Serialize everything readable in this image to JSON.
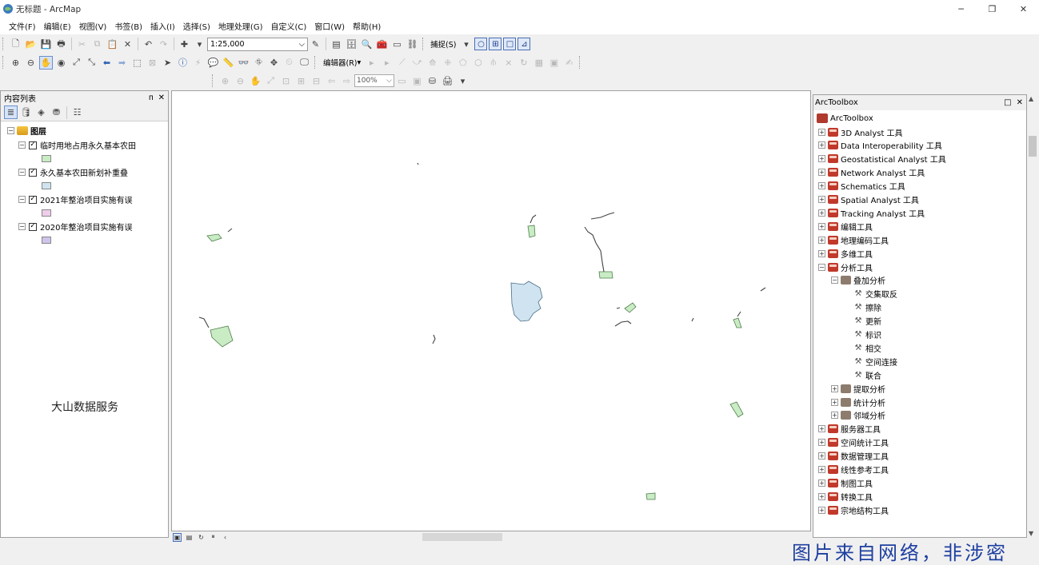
{
  "window": {
    "title": "无标题 - ArcMap",
    "minimize": "─",
    "maximize": "❐",
    "close": "✕"
  },
  "menu": [
    "文件(F)",
    "编辑(E)",
    "视图(V)",
    "书签(B)",
    "插入(I)",
    "选择(S)",
    "地理处理(G)",
    "自定义(C)",
    "窗口(W)",
    "帮助(H)"
  ],
  "toolbar": {
    "scale": "1:25,000",
    "snapping_label": "捕捉(S)",
    "editor_label": "编辑器(R)",
    "layout_zoom": "100%"
  },
  "toc": {
    "title": "内容列表",
    "pin": "ᴨ",
    "close": "✕",
    "root_label": "图层",
    "layers": [
      {
        "name": "临时用地占用永久基本农田",
        "checked": "✓",
        "color": "#c9ecc4"
      },
      {
        "name": "永久基本农田新划补重叠",
        "checked": "✓",
        "color": "#cfe4f0"
      },
      {
        "name": "2021年整治项目实施有误",
        "checked": "✓",
        "color": "#efcdeb"
      },
      {
        "name": "2020年整治项目实施有误",
        "checked": "✓",
        "color": "#cfc4ea"
      }
    ],
    "overlay_text": "大山数据服务"
  },
  "toolbox": {
    "title": "ArcToolbox",
    "restore": "□",
    "close": "✕",
    "root": "ArcToolbox",
    "items": [
      {
        "label": "3D Analyst 工具",
        "level": 0,
        "kind": "box",
        "exp": "+"
      },
      {
        "label": "Data Interoperability 工具",
        "level": 0,
        "kind": "box",
        "exp": "+"
      },
      {
        "label": "Geostatistical Analyst 工具",
        "level": 0,
        "kind": "box",
        "exp": "+"
      },
      {
        "label": "Network Analyst 工具",
        "level": 0,
        "kind": "box",
        "exp": "+"
      },
      {
        "label": "Schematics 工具",
        "level": 0,
        "kind": "box",
        "exp": "+"
      },
      {
        "label": "Spatial Analyst 工具",
        "level": 0,
        "kind": "box",
        "exp": "+"
      },
      {
        "label": "Tracking Analyst 工具",
        "level": 0,
        "kind": "box",
        "exp": "+"
      },
      {
        "label": "编辑工具",
        "level": 0,
        "kind": "box",
        "exp": "+"
      },
      {
        "label": "地理编码工具",
        "level": 0,
        "kind": "box",
        "exp": "+"
      },
      {
        "label": "多维工具",
        "level": 0,
        "kind": "box",
        "exp": "+"
      },
      {
        "label": "分析工具",
        "level": 0,
        "kind": "box",
        "exp": "−"
      },
      {
        "label": "叠加分析",
        "level": 1,
        "kind": "set",
        "exp": "−"
      },
      {
        "label": "交集取反",
        "level": 2,
        "kind": "tool",
        "exp": ""
      },
      {
        "label": "擦除",
        "level": 2,
        "kind": "tool",
        "exp": ""
      },
      {
        "label": "更新",
        "level": 2,
        "kind": "tool",
        "exp": ""
      },
      {
        "label": "标识",
        "level": 2,
        "kind": "tool",
        "exp": ""
      },
      {
        "label": "相交",
        "level": 2,
        "kind": "tool",
        "exp": ""
      },
      {
        "label": "空间连接",
        "level": 2,
        "kind": "tool",
        "exp": ""
      },
      {
        "label": "联合",
        "level": 2,
        "kind": "tool",
        "exp": ""
      },
      {
        "label": "提取分析",
        "level": 1,
        "kind": "set",
        "exp": "+"
      },
      {
        "label": "统计分析",
        "level": 1,
        "kind": "set",
        "exp": "+"
      },
      {
        "label": "邻域分析",
        "level": 1,
        "kind": "set",
        "exp": "+"
      },
      {
        "label": "服务器工具",
        "level": 0,
        "kind": "box",
        "exp": "+"
      },
      {
        "label": "空间统计工具",
        "level": 0,
        "kind": "box",
        "exp": "+"
      },
      {
        "label": "数据管理工具",
        "level": 0,
        "kind": "box",
        "exp": "+"
      },
      {
        "label": "线性参考工具",
        "level": 0,
        "kind": "box",
        "exp": "+"
      },
      {
        "label": "制图工具",
        "level": 0,
        "kind": "box",
        "exp": "+"
      },
      {
        "label": "转换工具",
        "level": 0,
        "kind": "box",
        "exp": "+"
      },
      {
        "label": "宗地结构工具",
        "level": 0,
        "kind": "box",
        "exp": "+"
      }
    ]
  },
  "watermark": "图片来自网络，非涉密",
  "colors": {
    "polygon_green": "#c9ecc4",
    "polygon_blue": "#cfe4f0",
    "watermark_blue": "#1e3fa0",
    "toolbox_red": "#c0392b"
  }
}
